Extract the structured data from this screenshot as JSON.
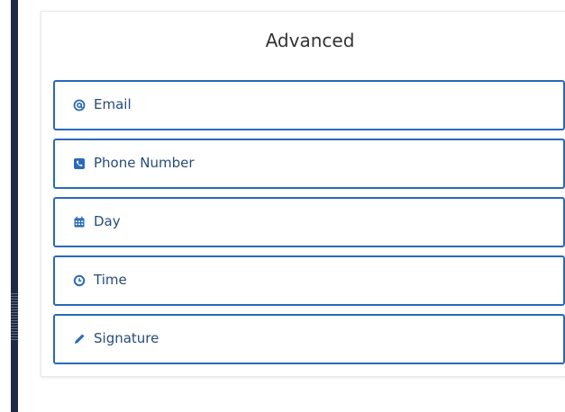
{
  "panel": {
    "title": "Advanced"
  },
  "fields": [
    {
      "label": "Email",
      "icon": "at-icon"
    },
    {
      "label": "Phone Number",
      "icon": "phone-icon"
    },
    {
      "label": "Day",
      "icon": "calendar-icon"
    },
    {
      "label": "Time",
      "icon": "clock-icon"
    },
    {
      "label": "Signature",
      "icon": "pencil-icon"
    }
  ],
  "colors": {
    "accent": "#2a69b8",
    "label": "#274b7a",
    "rail": "#1f2a44"
  }
}
